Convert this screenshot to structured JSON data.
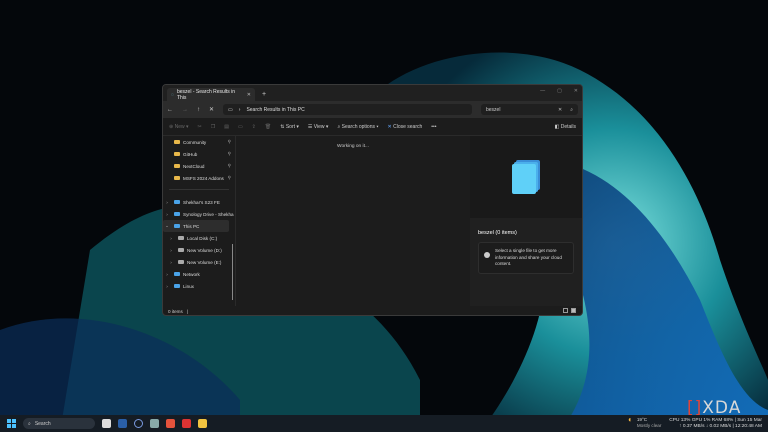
{
  "window": {
    "tab_title": "beszel - Search Results in This",
    "new_tab": "+",
    "address": "Search Results in This PC",
    "search_value": "beszel"
  },
  "toolbar": {
    "new": "New",
    "sort": "Sort",
    "view": "View",
    "search_options": "Search options",
    "close_search": "Close search",
    "more": "•••",
    "details": "Details"
  },
  "nav": {
    "pinned": [
      {
        "label": "Community"
      },
      {
        "label": "GitHub"
      },
      {
        "label": "NextCloud"
      },
      {
        "label": "MSFS 2024 Addons"
      }
    ],
    "items": [
      {
        "label": "Shekhar's S23 FE",
        "indent": 0
      },
      {
        "label": "Synology Drive - Shekha",
        "indent": 0
      },
      {
        "label": "This PC",
        "indent": 0,
        "expanded": true
      },
      {
        "label": "Local Disk (C:)",
        "indent": 1
      },
      {
        "label": "New Volume (D:)",
        "indent": 1
      },
      {
        "label": "New Volume (E:)",
        "indent": 1
      },
      {
        "label": "Network",
        "indent": 0
      },
      {
        "label": "Linux",
        "indent": 0
      }
    ]
  },
  "content": {
    "status": "Working on it..."
  },
  "details": {
    "title": "beszel (0 items)",
    "info": "Select a single file to get more information and share your cloud content."
  },
  "statusbar": {
    "count": "0 items",
    "sep": "|"
  },
  "taskbar": {
    "search": "Search"
  },
  "tray": {
    "temp": "19°C",
    "weather": "Mostly clear",
    "line1": "CPU 13% GPU  1% RAM 68% | Sun 15 Mar",
    "line2": "↑ 0.37 MB/s ↓ 0.02 MB/s | 12:20:48 AM"
  },
  "watermark": {
    "text": "XDA"
  }
}
